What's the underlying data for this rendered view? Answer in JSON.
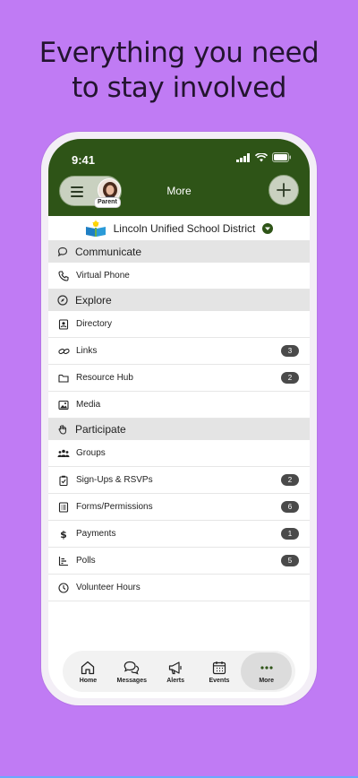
{
  "headline": {
    "line1": "Everything you need",
    "line2": "to stay involved"
  },
  "status": {
    "time": "9:41"
  },
  "header": {
    "title": "More",
    "avatar_badge": "Parent"
  },
  "district": {
    "name": "Lincoln Unified School District"
  },
  "sections": [
    {
      "label": "Communicate",
      "icon": "chat-icon",
      "items": [
        {
          "label": "Virtual Phone",
          "icon": "phone-icon",
          "badge": null
        }
      ]
    },
    {
      "label": "Explore",
      "icon": "compass-icon",
      "items": [
        {
          "label": "Directory",
          "icon": "contact-card-icon",
          "badge": null
        },
        {
          "label": "Links",
          "icon": "link-icon",
          "badge": "3"
        },
        {
          "label": "Resource Hub",
          "icon": "folder-icon",
          "badge": "2"
        },
        {
          "label": "Media",
          "icon": "image-icon",
          "badge": null
        }
      ]
    },
    {
      "label": "Participate",
      "icon": "hand-icon",
      "items": [
        {
          "label": "Groups",
          "icon": "people-icon",
          "badge": null
        },
        {
          "label": "Sign-Ups & RSVPs",
          "icon": "clipboard-check-icon",
          "badge": "2"
        },
        {
          "label": "Forms/Permissions",
          "icon": "form-icon",
          "badge": "6"
        },
        {
          "label": "Payments",
          "icon": "dollar-icon",
          "badge": "1"
        },
        {
          "label": "Polls",
          "icon": "poll-chart-icon",
          "badge": "5"
        },
        {
          "label": "Volunteer Hours",
          "icon": "clock-icon",
          "badge": null
        }
      ]
    }
  ],
  "tabs": [
    {
      "label": "Home",
      "icon": "home-icon"
    },
    {
      "label": "Messages",
      "icon": "messages-icon"
    },
    {
      "label": "Alerts",
      "icon": "megaphone-icon"
    },
    {
      "label": "Events",
      "icon": "calendar-icon"
    },
    {
      "label": "More",
      "icon": "more-dots-icon"
    }
  ],
  "colors": {
    "background": "#c07bf4",
    "brand_green": "#2e5417",
    "badge": "#4a4a4a"
  }
}
